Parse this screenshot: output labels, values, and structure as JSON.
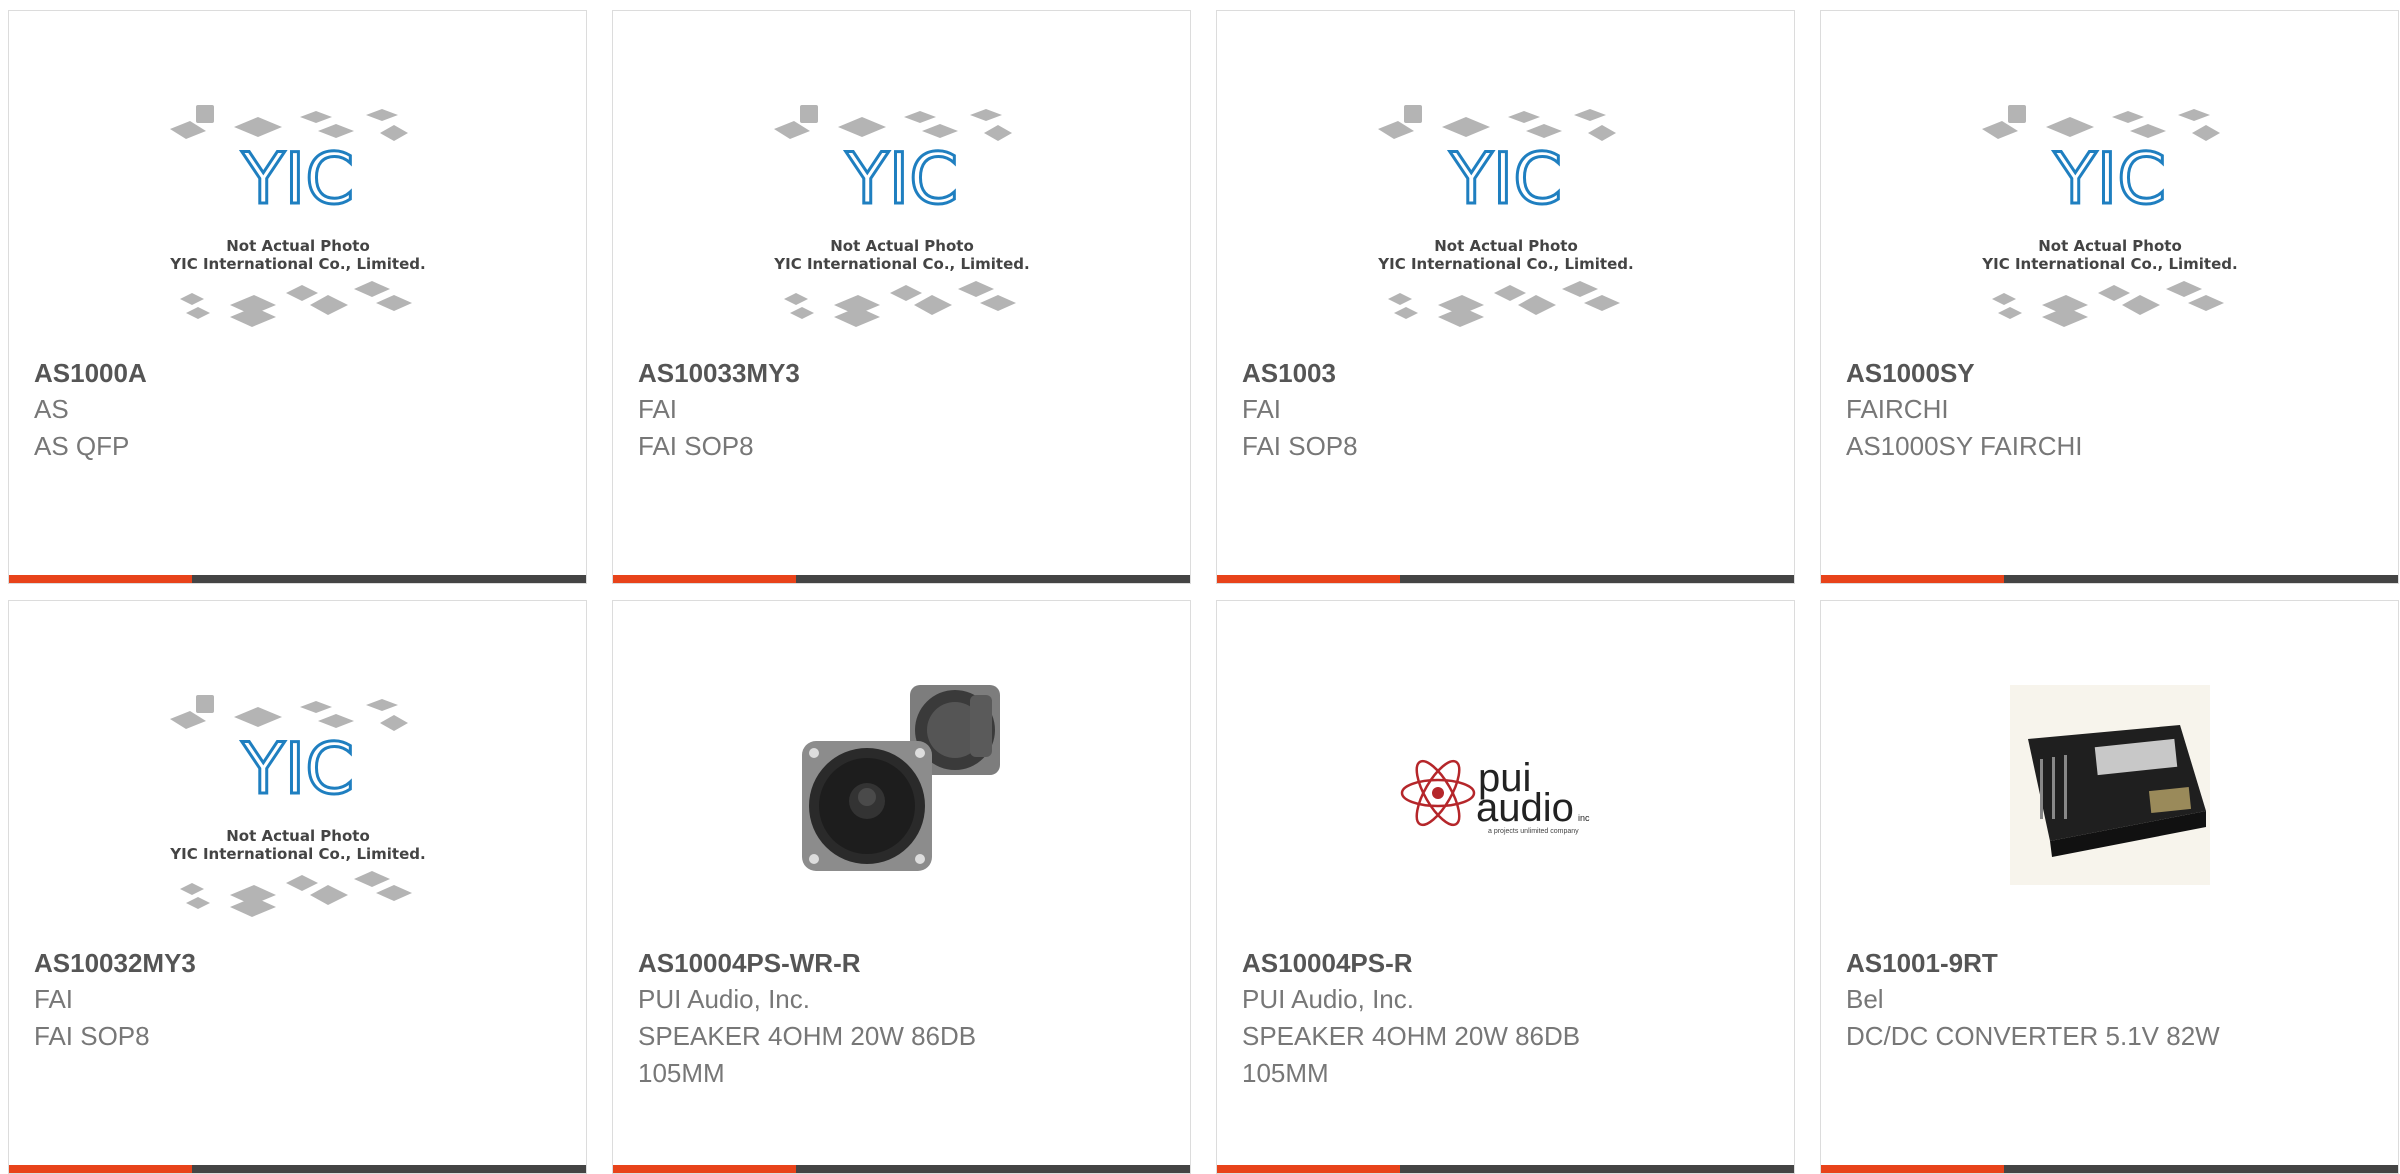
{
  "placeholder": {
    "logo_text": "YIC",
    "line1": "Not Actual Photo",
    "line2": "YIC International Co., Limited."
  },
  "pui_logo": {
    "word1": "pui",
    "word2": "audio",
    "suffix": "inc",
    "tagline": "a projects unlimited company"
  },
  "colors": {
    "accent": "#e8431a",
    "bar": "#444444",
    "yic_blue": "#1f7fc0"
  },
  "products": [
    {
      "part": "AS1000A",
      "brand": "AS",
      "desc": "AS QFP",
      "image": "placeholder"
    },
    {
      "part": "AS10033MY3",
      "brand": "FAI",
      "desc": "FAI SOP8",
      "image": "placeholder"
    },
    {
      "part": "AS1003",
      "brand": "FAI",
      "desc": "FAI SOP8",
      "image": "placeholder"
    },
    {
      "part": "AS1000SY",
      "brand": "FAIRCHI",
      "desc": "AS1000SY FAIRCHI",
      "image": "placeholder"
    },
    {
      "part": "AS10032MY3",
      "brand": "FAI",
      "desc": "FAI SOP8",
      "image": "placeholder"
    },
    {
      "part": "AS10004PS-WR-R",
      "brand": "PUI Audio, Inc.",
      "desc": "SPEAKER 4OHM 20W 86DB 105MM",
      "image": "speaker-photo"
    },
    {
      "part": "AS10004PS-R",
      "brand": "PUI Audio, Inc.",
      "desc": "SPEAKER 4OHM 20W 86DB 105MM",
      "image": "pui-audio-logo"
    },
    {
      "part": "AS1001-9RT",
      "brand": "Bel",
      "desc": "DC/DC CONVERTER 5.1V 82W",
      "image": "converter-photo"
    }
  ]
}
